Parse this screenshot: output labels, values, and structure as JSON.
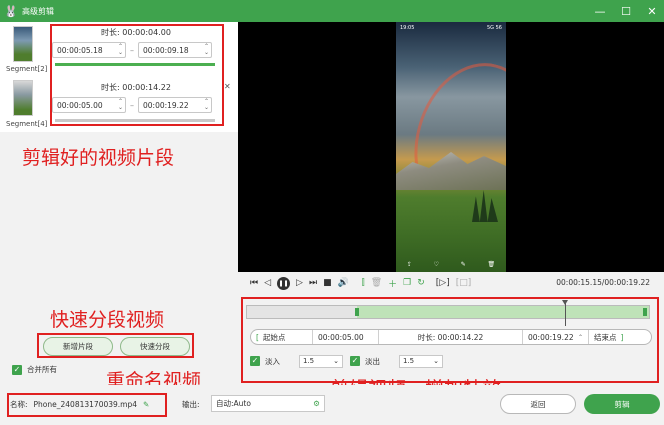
{
  "window": {
    "title": "高级剪辑",
    "logo_icon": "rabbit-icon"
  },
  "segments": [
    {
      "label": "Segment[2]",
      "duration_label": "时长:",
      "duration": "00:00:04.00",
      "start": "00:00:05.18",
      "end": "00:00:09.18"
    },
    {
      "label": "Segment[4]",
      "duration_label": "时长:",
      "duration": "00:00:14.22",
      "start": "00:00:05.00",
      "end": "00:00:19.22"
    }
  ],
  "left": {
    "add_segment": "新增片段",
    "quick_split": "快速分段",
    "merge_all": "合并所有"
  },
  "annotations": {
    "clipped_segments": "剪辑好的视频片段",
    "quick_split": "快速分段视频",
    "rename": "重命名视频",
    "edit_effects": "剪辑视频、增加特效"
  },
  "phone": {
    "status_left": "19:05",
    "status_right": "5G 56"
  },
  "playback": {
    "timecode": "00:00:15.15/00:00:19.22"
  },
  "trim": {
    "start_btn": "起始点",
    "start_value": "00:00:05.00",
    "duration_label": "时长:",
    "duration_value": "00:00:14.22",
    "end_value": "00:00:19.22",
    "end_btn": "结束点"
  },
  "fade": {
    "fade_in_label": "淡入",
    "fade_in_value": "1.5",
    "fade_out_label": "淡出",
    "fade_out_value": "1.5"
  },
  "footer": {
    "name_label": "名称:",
    "name_value": "Phone_240813170039.mp4",
    "output_label": "输出:",
    "output_value": "自动:Auto",
    "back": "返回",
    "clip": "剪辑"
  },
  "colors": {
    "accent": "#3fa34d",
    "annotation": "#e02020"
  }
}
